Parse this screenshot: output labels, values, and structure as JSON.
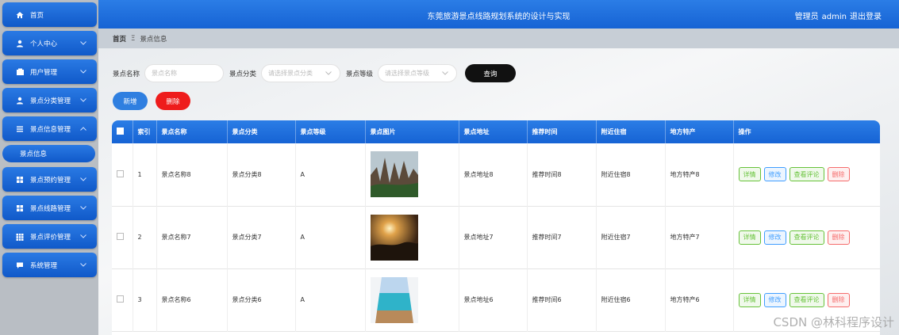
{
  "sidebar": {
    "items": [
      {
        "label": "首页",
        "icon": "home-icon"
      },
      {
        "label": "个人中心",
        "icon": "user-icon"
      },
      {
        "label": "用户管理",
        "icon": "user-manage-icon"
      },
      {
        "label": "景点分类管理",
        "icon": "category-icon"
      },
      {
        "label": "景点信息管理",
        "icon": "list-icon"
      },
      {
        "label": "景点预约管理",
        "icon": "grid-icon"
      },
      {
        "label": "景点线路管理",
        "icon": "grid-icon"
      },
      {
        "label": "景点评价管理",
        "icon": "grid-icon"
      },
      {
        "label": "系统管理",
        "icon": "message-icon"
      }
    ],
    "sub_item": "景点信息"
  },
  "header": {
    "title": "东莞旅游景点线路规划系统的设计与实现",
    "user_prefix": "管理员",
    "user_name": "admin",
    "logout": "退出登录"
  },
  "breadcrumb": {
    "home": "首页",
    "separator": "Ξ",
    "current": "景点信息"
  },
  "search": {
    "name_label": "景点名称",
    "name_placeholder": "景点名称",
    "category_label": "景点分类",
    "category_placeholder": "请选择景点分类",
    "level_label": "景点等级",
    "level_placeholder": "请选择景点等级",
    "query_button": "查询"
  },
  "actions": {
    "add": "新增",
    "delete": "删除"
  },
  "table": {
    "headers": [
      "索引",
      "景点名称",
      "景点分类",
      "景点等级",
      "景点图片",
      "景点地址",
      "推荐时间",
      "附近住宿",
      "地方特产",
      "操作"
    ],
    "rows": [
      {
        "index": "1",
        "name": "景点名称8",
        "category": "景点分类8",
        "level": "A",
        "address": "景点地址8",
        "time": "推荐时间8",
        "lodging": "附近住宿8",
        "specialty": "地方特产8"
      },
      {
        "index": "2",
        "name": "景点名称7",
        "category": "景点分类7",
        "level": "A",
        "address": "景点地址7",
        "time": "推荐时间7",
        "lodging": "附近住宿7",
        "specialty": "地方特产7"
      },
      {
        "index": "3",
        "name": "景点名称6",
        "category": "景点分类6",
        "level": "A",
        "address": "景点地址6",
        "time": "推荐时间6",
        "lodging": "附近住宿6",
        "specialty": "地方特产6"
      }
    ],
    "ops": {
      "detail": "详情",
      "edit": "修改",
      "comment": "查看评论",
      "delete": "删除"
    }
  },
  "watermark": "CSDN @林科程序设计",
  "colors": {
    "primary": "#1663d4",
    "danger": "#ee1c1c",
    "query": "#111111"
  }
}
